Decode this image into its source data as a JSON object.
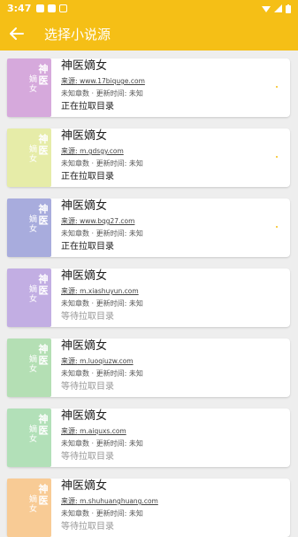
{
  "status": {
    "time": "3:47"
  },
  "header": {
    "title": "选择小说源"
  },
  "sources": [
    {
      "cover_color": "#d6a9dc",
      "cover_title": "神医",
      "cover_sub": "嫡女",
      "name": "神医嫡女",
      "source_label": "来源:",
      "source": "www.17biquge.com",
      "update": "未知章数 · 更新时间: 未知",
      "status": "正在拉取目录",
      "loading": true
    },
    {
      "cover_color": "#e6eca8",
      "cover_title": "神医",
      "cover_sub": "嫡女",
      "name": "神医嫡女",
      "source_label": "来源:",
      "source": "m.gdsgy.com",
      "update": "未知章数 · 更新时间: 未知",
      "status": "正在拉取目录",
      "loading": true
    },
    {
      "cover_color": "#a8acdd",
      "cover_title": "神医",
      "cover_sub": "嫡女",
      "name": "神医嫡女",
      "source_label": "来源:",
      "source": "www.bqg27.com",
      "update": "未知章数 · 更新时间: 未知",
      "status": "正在拉取目录",
      "loading": true
    },
    {
      "cover_color": "#c2aee3",
      "cover_title": "神医",
      "cover_sub": "嫡女",
      "name": "神医嫡女",
      "source_label": "来源:",
      "source": "m.xiashuyun.com",
      "update": "未知章数 · 更新时间: 未知",
      "status": "等待拉取目录",
      "loading": false
    },
    {
      "cover_color": "#b4dfb4",
      "cover_title": "神医",
      "cover_sub": "嫡女",
      "name": "神医嫡女",
      "source_label": "来源:",
      "source": "m.luoqiuzw.com",
      "update": "未知章数 · 更新时间: 未知",
      "status": "等待拉取目录",
      "loading": false
    },
    {
      "cover_color": "#b2e0b8",
      "cover_title": "神医",
      "cover_sub": "嫡女",
      "name": "神医嫡女",
      "source_label": "来源:",
      "source": "m.aiquxs.com",
      "update": "未知章数 · 更新时间: 未知",
      "status": "等待拉取目录",
      "loading": false
    },
    {
      "cover_color": "#f8cb95",
      "cover_title": "神医",
      "cover_sub": "嫡女",
      "name": "神医嫡女",
      "source_label": "来源:",
      "source": "m.shuhuanghuang.com",
      "update": "未知章数 · 更新时间: 未知",
      "status": "等待拉取目录",
      "loading": false
    }
  ]
}
